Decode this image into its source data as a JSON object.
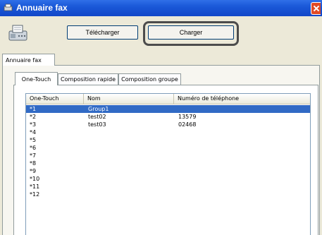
{
  "window": {
    "title": "Annuaire fax"
  },
  "toolbar": {
    "download_label": "Télécharger",
    "load_label": "Charger"
  },
  "outer_tab": {
    "label": "Annuaire fax"
  },
  "inner_tabs": [
    {
      "label": "One-Touch",
      "active": true
    },
    {
      "label": "Composition rapide",
      "active": false
    },
    {
      "label": "Composition groupe",
      "active": false
    }
  ],
  "list": {
    "columns": [
      "One-Touch",
      "Nom",
      "Numéro de téléphone"
    ],
    "rows": [
      {
        "key": "*1",
        "name": "Group1",
        "phone": "",
        "selected": true
      },
      {
        "key": "*2",
        "name": "test02",
        "phone": "13579",
        "selected": false
      },
      {
        "key": "*3",
        "name": "test03",
        "phone": "02468",
        "selected": false
      },
      {
        "key": "*4",
        "name": "",
        "phone": "",
        "selected": false
      },
      {
        "key": "*5",
        "name": "",
        "phone": "",
        "selected": false
      },
      {
        "key": "*6",
        "name": "",
        "phone": "",
        "selected": false
      },
      {
        "key": "*7",
        "name": "",
        "phone": "",
        "selected": false
      },
      {
        "key": "*8",
        "name": "",
        "phone": "",
        "selected": false
      },
      {
        "key": "*9",
        "name": "",
        "phone": "",
        "selected": false
      },
      {
        "key": "*10",
        "name": "",
        "phone": "",
        "selected": false
      },
      {
        "key": "*11",
        "name": "",
        "phone": "",
        "selected": false
      },
      {
        "key": "*12",
        "name": "",
        "phone": "",
        "selected": false
      }
    ]
  },
  "colors": {
    "titlebar": "#1a58d8",
    "selection": "#316ac5",
    "highlight_border": "#4c4c4c"
  }
}
